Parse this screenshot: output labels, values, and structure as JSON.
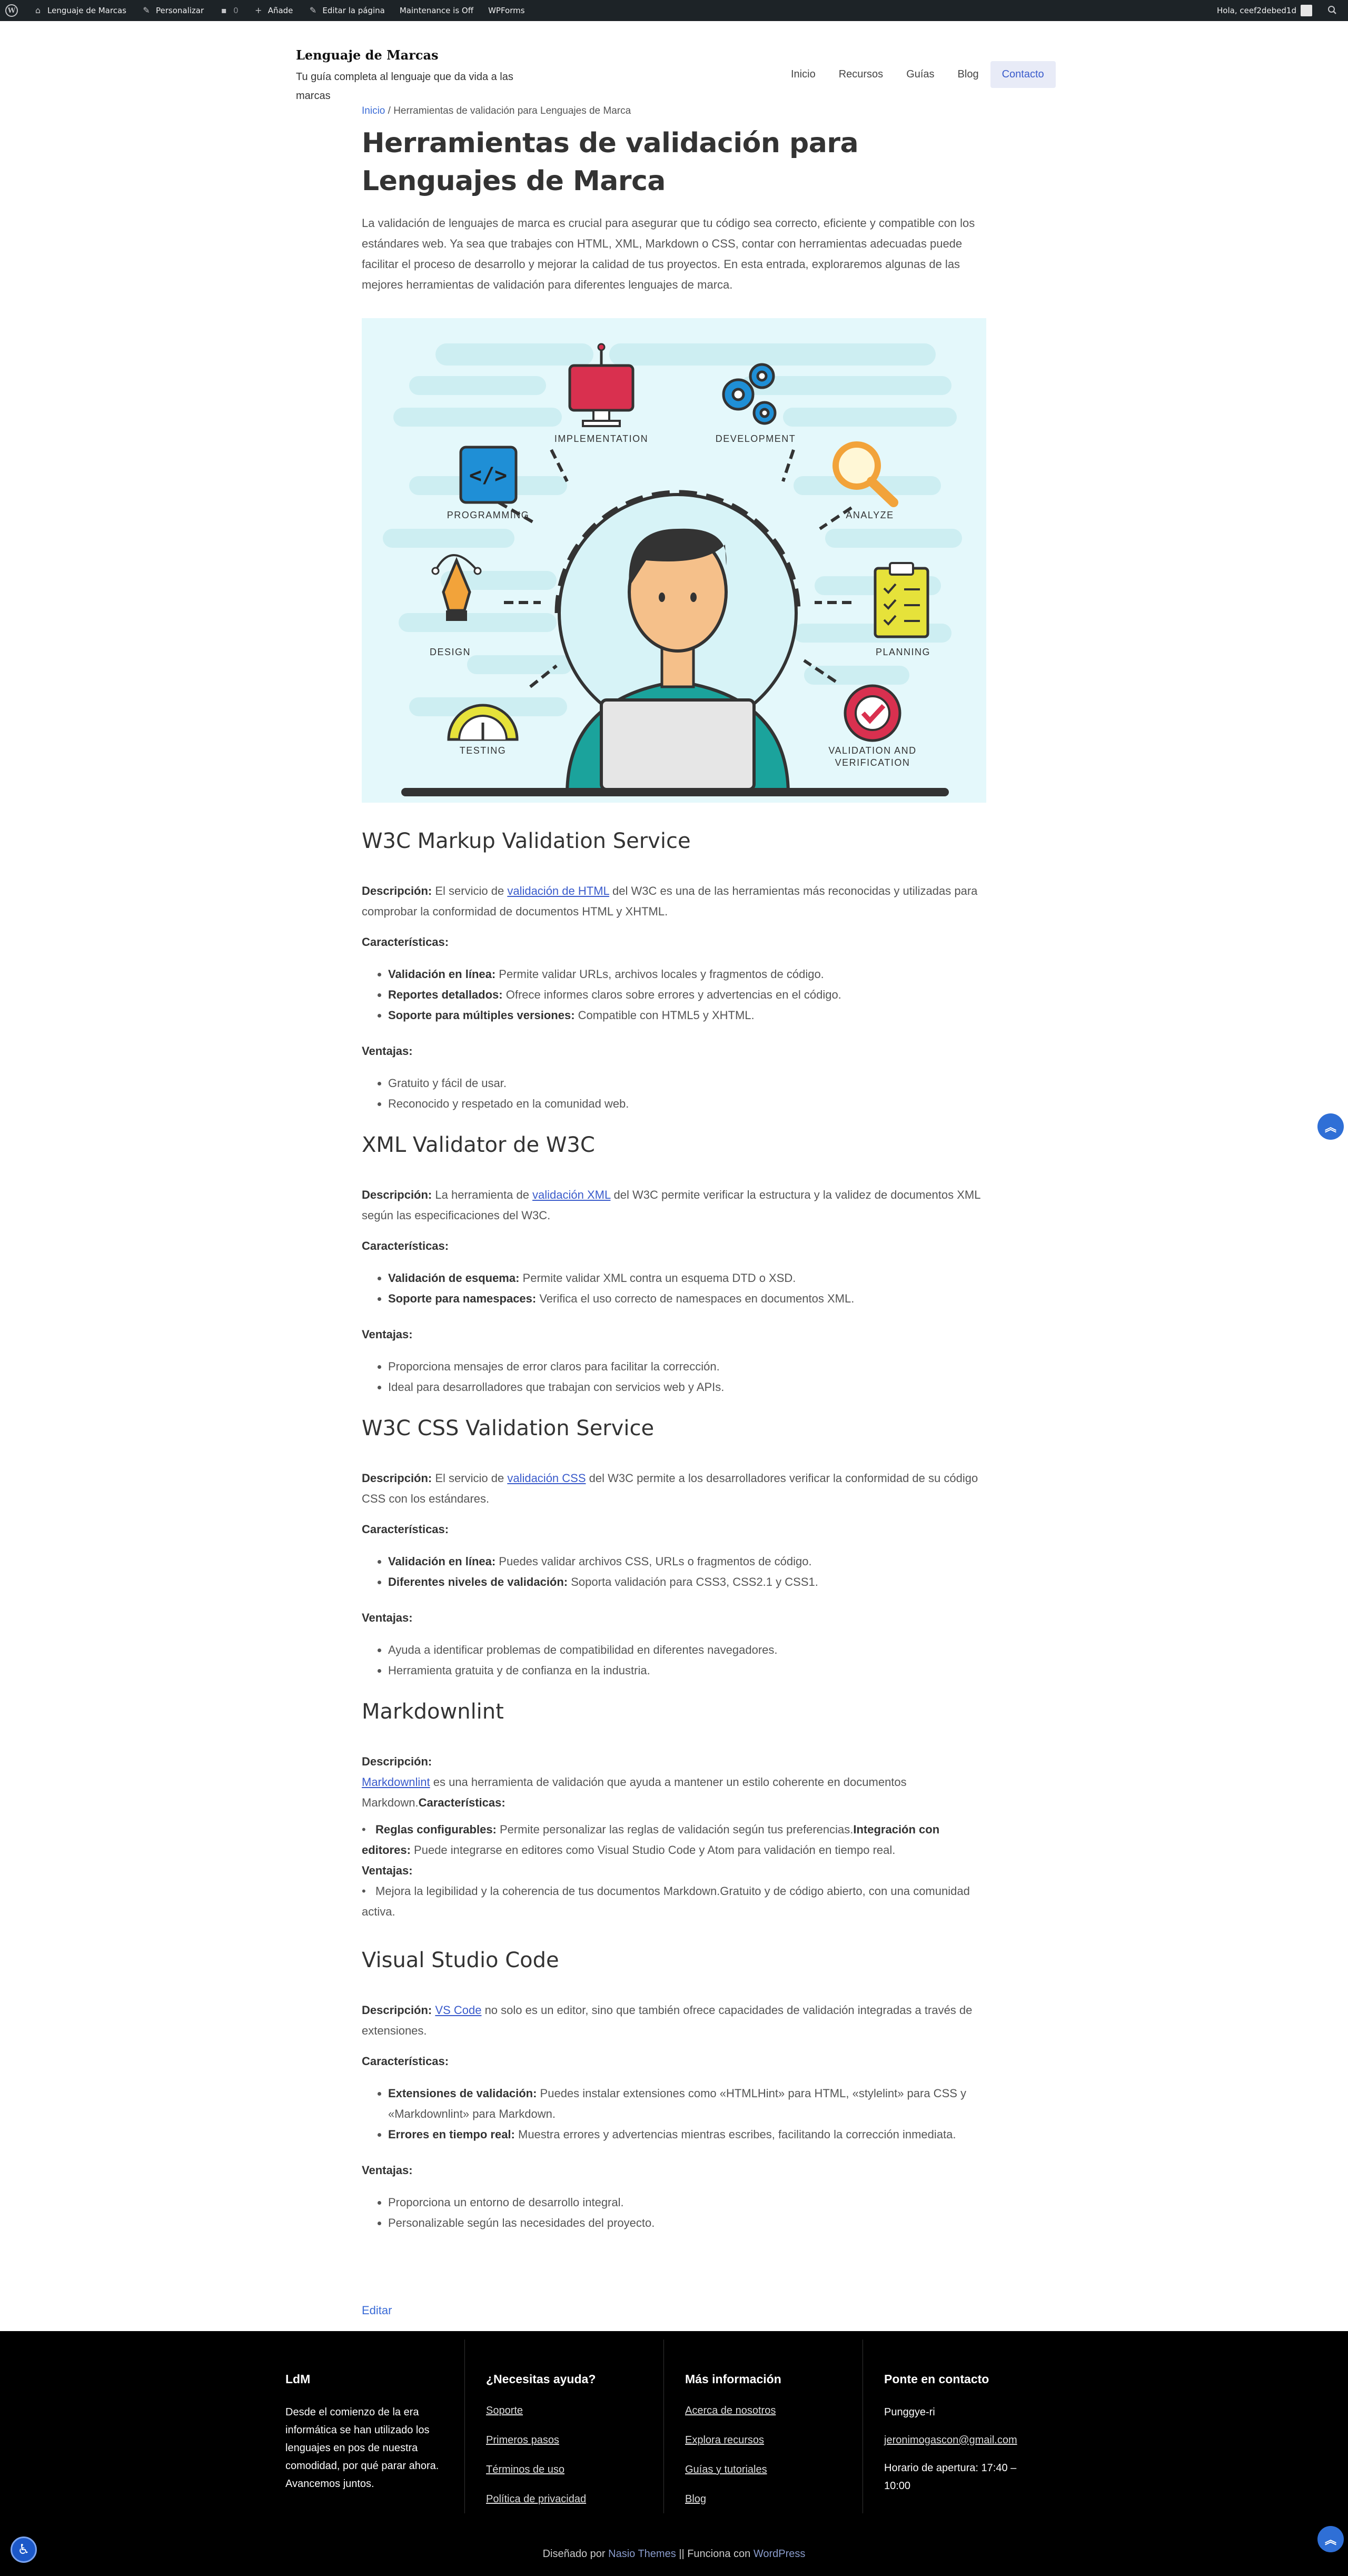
{
  "adminbar": {
    "site": "Lenguaje de Marcas",
    "customize": "Personalizar",
    "comments": "0",
    "new": "Añade",
    "edit": "Editar la página",
    "maintenance": "Maintenance is Off",
    "wpforms": "WPForms",
    "greeting": "Hola, ceef2debed1d"
  },
  "header": {
    "title": "Lenguaje de Marcas",
    "tagline": "Tu guía completa al lenguaje que da vida a las marcas",
    "nav": [
      "Inicio",
      "Recursos",
      "Guías",
      "Blog",
      "Contacto"
    ]
  },
  "breadcrumb": {
    "home": "Inicio",
    "sep": " / ",
    "current": "Herramientas de validación para Lenguajes de Marca"
  },
  "page_title": "Herramientas de validación para Lenguajes de Marca",
  "intro": "La validación de lenguajes de marca es crucial para asegurar que tu código sea correcto, eficiente y compatible con los estándares web. Ya sea que trabajes con HTML, XML, Markdown o CSS, contar con herramientas adecuadas puede facilitar el proceso de desarrollo y mejorar la calidad de tus proyectos. En esta entrada, exploraremos algunas de las mejores herramientas de validación para diferentes lenguajes de marca.",
  "hero": {
    "labels": {
      "implementation": "IMPLEMENTATION",
      "development": "DEVELOPMENT",
      "programming": "PROGRAMMING",
      "analyze": "ANALYZE",
      "design": "DESIGN",
      "planning": "PLANNING",
      "testing": "TESTING",
      "validation1": "VALIDATION AND",
      "validation2": "VERIFICATION"
    },
    "colors": {
      "bg": "#e4f8fb",
      "teal": "#1ba39c",
      "red": "#d9304f",
      "blue": "#1f8fd6",
      "yellow": "#e6e23a",
      "orange": "#f2a33a"
    }
  },
  "labels": {
    "descripcion": "Descripción:",
    "caracteristicas": "Características:",
    "ventajas": "Ventajas:"
  },
  "s1": {
    "title": "W3C Markup Validation Service",
    "desc_pre": " El servicio de ",
    "desc_link": "validación de HTML",
    "desc_post": " del W3C es una de las herramientas más reconocidas y utilizadas para comprobar la conformidad de documentos HTML y XHTML.",
    "features": [
      {
        "b": "Validación en línea:",
        "t": " Permite validar URLs, archivos locales y fragmentos de código."
      },
      {
        "b": "Reportes detallados:",
        "t": " Ofrece informes claros sobre errores y advertencias en el código."
      },
      {
        "b": "Soporte para múltiples versiones:",
        "t": " Compatible con HTML5 y XHTML."
      }
    ],
    "advantages": [
      "Gratuito y fácil de usar.",
      "Reconocido y respetado en la comunidad web."
    ]
  },
  "s2": {
    "title": "XML Validator de W3C",
    "desc_pre": " La herramienta de ",
    "desc_link": "validación XML",
    "desc_post": " del W3C permite verificar la estructura y la validez de documentos XML según las especificaciones del W3C.",
    "features": [
      {
        "b": "Validación de esquema:",
        "t": " Permite validar XML contra un esquema DTD o XSD."
      },
      {
        "b": "Soporte para namespaces:",
        "t": " Verifica el uso correcto de namespaces en documentos XML."
      }
    ],
    "advantages": [
      "Proporciona mensajes de error claros para facilitar la corrección.",
      "Ideal para desarrolladores que trabajan con servicios web y APIs."
    ]
  },
  "s3": {
    "title": "W3C CSS Validation Service",
    "desc_pre": " El servicio de ",
    "desc_link": "validación CSS",
    "desc_post": " del W3C permite a los desarrolladores verificar la conformidad de su código CSS con los estándares.",
    "features": [
      {
        "b": "Validación en línea:",
        "t": " Puedes validar archivos CSS, URLs o fragmentos de código."
      },
      {
        "b": "Diferentes niveles de validación:",
        "t": " Soporta validación para CSS3, CSS2.1 y CSS1."
      }
    ],
    "advantages": [
      "Ayuda a identificar problemas de compatibilidad en diferentes navegadores.",
      "Herramienta gratuita y de confianza en la industria."
    ]
  },
  "s4": {
    "title": "Markdownlint",
    "desc_link": "Markdownlint",
    "desc_post": " es una herramienta de validación que ayuda a mantener un estilo coherente en documentos Markdown.",
    "feat1_b": "Reglas configurables:",
    "feat1_t": " Permite personalizar las reglas de validación según tus preferencias.",
    "feat2_b": "Integración con editores:",
    "feat2_t": " Puede integrarse en editores como Visual Studio Code y Atom para validación en tiempo real.",
    "adv_text": "Mejora la legibilidad y la coherencia de tus documentos Markdown.Gratuito y de código abierto, con una comunidad activa."
  },
  "s5": {
    "title": "Visual Studio Code",
    "desc_link": "VS Code",
    "desc_post": " no solo es un editor, sino que también ofrece capacidades de validación integradas a través de extensiones.",
    "features": [
      {
        "b": "Extensiones de validación:",
        "t": " Puedes instalar extensiones como «HTMLHint» para HTML, «stylelint» para CSS y «Markdownlint» para Markdown."
      },
      {
        "b": "Errores en tiempo real:",
        "t": " Muestra errores y advertencias mientras escribes, facilitando la corrección inmediata."
      }
    ],
    "advantages": [
      "Proporciona un entorno de desarrollo integral.",
      "Personalizable según las necesidades del proyecto."
    ]
  },
  "edit_link": "Editar",
  "footer": {
    "col1": {
      "title": "LdM",
      "text": "Desde el comienzo de la era informática se han utilizado los lenguajes en pos de nuestra comodidad, por qué parar ahora. Avancemos juntos."
    },
    "col2": {
      "title": "¿Necesitas ayuda?",
      "links": [
        "Soporte",
        "Primeros pasos",
        "Términos de uso",
        "Política de privacidad"
      ]
    },
    "col3": {
      "title": "Más información",
      "links": [
        "Acerca de nosotros",
        "Explora recursos",
        "Guías y tutoriales",
        "Blog"
      ]
    },
    "col4": {
      "title": "Ponte en contacto",
      "place": "Punggye-ri",
      "email": "jeronimogascon@gmail.com",
      "hours": "Horario de apertura: 17:40 – 10:00"
    },
    "credits_pre": "Diseñado por ",
    "credits_theme": "Nasio Themes",
    "credits_mid": " || Funciona con ",
    "credits_wp": "WordPress"
  }
}
